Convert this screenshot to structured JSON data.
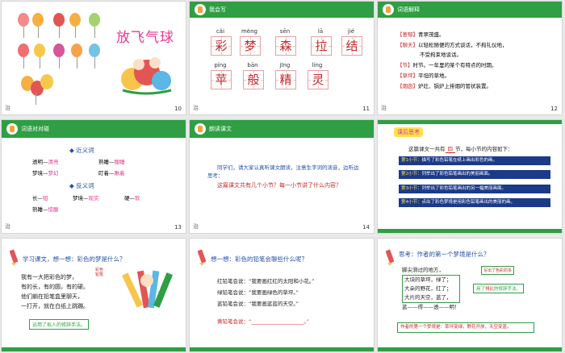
{
  "slides": [
    {
      "id": 1,
      "num": "10",
      "title": "放飞气球",
      "hash": "治"
    },
    {
      "id": 2,
      "num": "11",
      "hash": "治",
      "header": "我会写",
      "chars": [
        {
          "py": "cǎi",
          "hz": "彩"
        },
        {
          "py": "mèng",
          "hz": "梦"
        },
        {
          "py": "sēn",
          "hz": "森"
        },
        {
          "py": "lā",
          "hz": "拉"
        },
        {
          "py": "jié",
          "hz": "结"
        },
        {
          "py": "píng",
          "hz": "苹"
        },
        {
          "py": "bān",
          "hz": "般"
        },
        {
          "py": "jīng",
          "hz": "精"
        },
        {
          "py": "líng",
          "hz": "灵"
        }
      ]
    },
    {
      "id": 3,
      "num": "12",
      "hash": "治",
      "header": "词语解释",
      "lines": [
        {
          "k": "【葱郁】",
          "v": "青翠茂盛。"
        },
        {
          "k": "【聊天】",
          "v": "以轻松随便的方式谈话，不拘礼仪地，"
        },
        {
          "k": "",
          "v": "不受拘束地谈话。"
        },
        {
          "k": "【节】",
          "v": "时节。一年里的某个有特点的时期。"
        },
        {
          "k": "【草坪】",
          "v": "平坦的草地。"
        },
        {
          "k": "【烟囱】",
          "v": "炉灶、锅炉上排烟的管状装置。"
        }
      ]
    },
    {
      "id": 4,
      "num": "13",
      "hash": "治",
      "header": "词语对对碰",
      "syn_title": "近义词",
      "ant_title": "反义词",
      "syn": [
        [
          "透明",
          "清亮"
        ],
        [
          "熟睡",
          "酣睡"
        ],
        [
          "梦境",
          "梦幻"
        ],
        [
          "盯着",
          "瞅着"
        ]
      ],
      "ant": [
        [
          "长",
          "短"
        ],
        [
          "梦境",
          "现实"
        ],
        [
          "硬",
          "软"
        ],
        [
          "熟睡",
          "惊醒"
        ]
      ]
    },
    {
      "id": 5,
      "num": "14",
      "hash": "治",
      "header": "朗读课文",
      "text1": "同学们，请大家认真听课文朗读，注意生字词的读音，边听边思考：",
      "text2": "这篇课文共有几个小节？每一小节讲了什么内容？"
    },
    {
      "id": 6,
      "num": "15",
      "hash": "治",
      "badge": "课后思考",
      "intro_a": "这篇课文一共有",
      "intro_n": "四",
      "intro_b": "节，每小节的内容如下：",
      "rows": [
        {
          "k": "第1小节：",
          "v": "描写了彩色铅笔在纸上画出彩色的画。"
        },
        {
          "k": "第2小节：",
          "v": "列举出了彩色铅笔画出的美丽画面。"
        },
        {
          "k": "第3小节：",
          "v": "列举出了彩色铅笔画出的另一幅美丽画面。"
        },
        {
          "k": "第4小节：",
          "v": "点出了彩色梦境是用彩色铅笔画出的美丽的画。"
        }
      ]
    },
    {
      "id": 7,
      "num": "16",
      "hash": "治",
      "question": "学习课文，想一想：彩色的梦是什么？",
      "poem": [
        "我有一大把彩色的梦，",
        "有的长，有的圆，有的硬。",
        "他们躺在铅笔盒里聊天，",
        "一打开，就在白纸上跳蹦。"
      ],
      "note": "运用了拟人的修辞手法。",
      "label": "彩色铅笔"
    },
    {
      "id": 8,
      "num": "17",
      "hash": "治",
      "question": "想一想：彩色的铅笔会聊些什么呢？",
      "lines": [
        "红铅笔会说：“我要画红红的太阳和小花。”",
        "绿铅笔会说：“我要画绿色的草坪。”",
        "蓝铅笔会说：“我要画蓝蓝的天空。”"
      ],
      "blank": "黄铅笔会说：“____________________。”"
    },
    {
      "id": 9,
      "num": "18",
      "hash": "治",
      "question": "思考：作者的第一个梦境是什么？",
      "poem": [
        "脚尖滑过的地方，",
        "大块的草坪，绿了；",
        "大朵的野花，红了；",
        "大片的天空，蓝了，",
        "蓝——得——透——明！"
      ],
      "tag_a": "用了",
      "tag_b": "排比",
      "tag_c": "的修辞手法。",
      "side_note": "写出了色彩的多",
      "bottom": "作者的第一个梦境是：草坪变绿，野花开放，天空变蓝。"
    }
  ],
  "colors": {
    "green": "#2f9e44",
    "red": "#c52b2b",
    "blue": "#2250a8",
    "pink": "#e23c8f",
    "navy": "#1c3a8a"
  }
}
